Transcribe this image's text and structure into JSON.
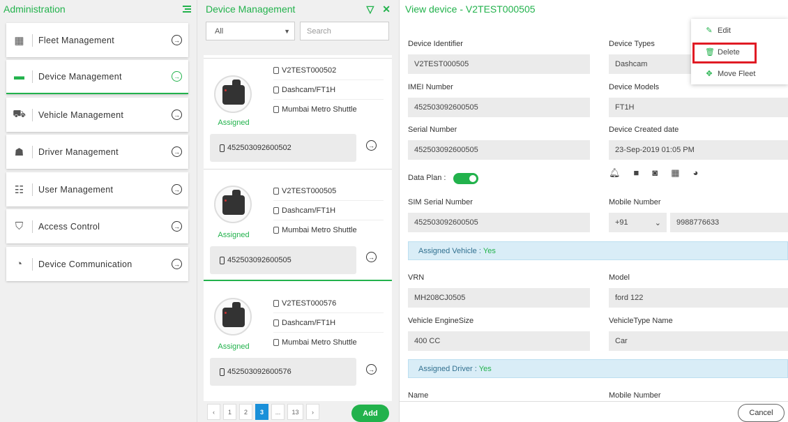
{
  "admin": {
    "title": "Administration",
    "items": [
      {
        "label": "Fleet Management",
        "icon": "building-car-icon"
      },
      {
        "label": "Device Management",
        "icon": "device-icon",
        "active": true
      },
      {
        "label": "Vehicle Management",
        "icon": "vehicle-icon"
      },
      {
        "label": "Driver Management",
        "icon": "driver-icon"
      },
      {
        "label": "User Management",
        "icon": "users-icon"
      },
      {
        "label": "Access Control",
        "icon": "shield-icon"
      },
      {
        "label": "Device Communication",
        "icon": "satellite-icon"
      }
    ]
  },
  "devlist": {
    "title": "Device Management",
    "filter_value": "All",
    "search_placeholder": "Search",
    "devices": [
      {
        "id": "V2TEST000502",
        "model": "Dashcam/FT1H",
        "fleet": "Mumbai Metro Shuttle",
        "status": "Assigned",
        "imei": "452503092600502"
      },
      {
        "id": "V2TEST000505",
        "model": "Dashcam/FT1H",
        "fleet": "Mumbai Metro Shuttle",
        "status": "Assigned",
        "imei": "452503092600505",
        "selected": true
      },
      {
        "id": "V2TEST000576",
        "model": "Dashcam/FT1H",
        "fleet": "Mumbai Metro Shuttle",
        "status": "Assigned",
        "imei": "452503092600576"
      }
    ],
    "pager": [
      "‹",
      "1",
      "2",
      "3",
      "...",
      "13",
      "›"
    ],
    "pager_active": "3",
    "add_label": "Add"
  },
  "view": {
    "title": "View device - V2TEST000505",
    "device_identifier_label": "Device Identifier",
    "device_identifier": "V2TEST000505",
    "device_types_label": "Device Types",
    "device_types": "Dashcam",
    "imei_label": "IMEI Number",
    "imei": "452503092600505",
    "device_models_label": "Device Models",
    "device_models": "FT1H",
    "serial_label": "Serial Number",
    "serial": "452503092600505",
    "created_label": "Device Created date",
    "created": "23-Sep-2019 01:05 PM",
    "data_plan_label": "Data Plan :",
    "data_plan_on": true,
    "sim_label": "SIM Serial Number",
    "sim": "452503092600505",
    "mobile_label": "Mobile Number",
    "country_code": "+91",
    "mobile": "9988776633",
    "assigned_vehicle_label": "Assigned Vehicle :",
    "assigned_vehicle_value": "Yes",
    "vrn_label": "VRN",
    "vrn": "MH208CJ0505",
    "model_label": "Model",
    "model": "ford 122",
    "engine_label": "Vehicle EngineSize",
    "engine": "400 CC",
    "vtype_label": "VehicleType Name",
    "vtype": "Car",
    "assigned_driver_label": "Assigned Driver :",
    "assigned_driver_value": "Yes",
    "name_label": "Name",
    "driver_mobile_label": "Mobile Number",
    "cancel_label": "Cancel"
  },
  "popup": {
    "edit": "Edit",
    "delete": "Delete",
    "move": "Move Fleet"
  },
  "colors": {
    "accent": "#22b24c",
    "highlight": "#e01b24",
    "pager_active": "#1a90d9"
  }
}
